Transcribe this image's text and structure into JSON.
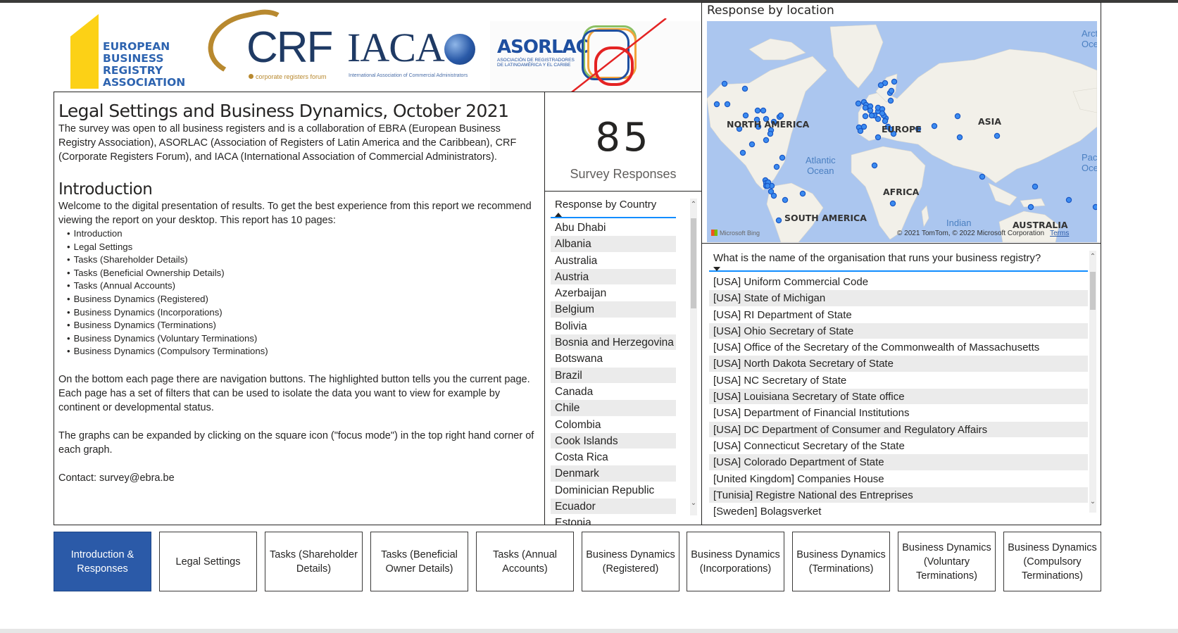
{
  "logos": {
    "ebra": {
      "lines": [
        "EUROPEAN",
        "BUSINESS",
        "REGISTRY",
        "ASSOCIATION"
      ]
    },
    "crf": {
      "name": "CRF",
      "subtitle": "corporate registers forum"
    },
    "iaca": {
      "name": "IACA",
      "subtitle": "International Association of Commercial Administrators"
    },
    "asorlac": {
      "name": "ASORLAC",
      "subtitle_1": "ASOCIACIÓN DE REGISTRADORES",
      "subtitle_2": "DE LATINOAMÉRICA Y EL CARIBE"
    }
  },
  "intro": {
    "title": "Legal Settings and Business Dynamics, October 2021",
    "description": "The survey was open to all business registers and is a collaboration of EBRA (European Business Registry Association), ASORLAC (Association of Registers of Latin America and the Caribbean), CRF (Corporate Registers Forum),  and IACA (International Association of Commercial Administrators).",
    "section_title": "Introduction",
    "welcome": "Welcome to the digital presentation of results. To get the best experience from this report we recommend viewing the report on your desktop. This report has 10 pages:",
    "pages": [
      "Introduction",
      "Legal Settings",
      "Tasks (Shareholder Details)",
      "Tasks (Beneficial Ownership Details)",
      "Tasks (Annual Accounts)",
      "Business Dynamics (Registered)",
      "Business Dynamics (Incorporations)",
      "Business Dynamics (Terminations)",
      "Business Dynamics (Voluntary Terminations)",
      "Business Dynamics (Compulsory Terminations)"
    ],
    "navigation_note": "On the bottom each page there are navigation buttons. The highlighted button tells you the current page. Each page has a set of filters that can be used to isolate the data you want to view for example by continent or developmental status.",
    "focus_note": "The graphs can be expanded by clicking on the square icon (\"focus mode\") in the top right hand corner of each graph.",
    "contact": "Contact: survey@ebra.be"
  },
  "kpi": {
    "value": "85",
    "label": "Survey Responses"
  },
  "country_table": {
    "header": "Response by Country",
    "sort": "ascending",
    "rows": [
      "Abu Dhabi",
      "Albania",
      "Australia",
      "Austria",
      "Azerbaijan",
      "Belgium",
      "Bolivia",
      "Bosnia and Herzegovina",
      "Botswana",
      "Brazil",
      "Canada",
      "Chile",
      "Colombia",
      "Cook Islands",
      "Costa Rica",
      "Denmark",
      "Dominician Republic",
      "Ecuador",
      "Estonia"
    ]
  },
  "map": {
    "title": "Response by location",
    "labels": {
      "north_america": "NORTH AMERICA",
      "south_america": "SOUTH AMERICA",
      "europe": "EUROPE",
      "asia": "ASIA",
      "africa": "AFRICA",
      "australia": "AUSTRALIA"
    },
    "oceans": {
      "atlantic": "Atlantic\nOcean",
      "indian": "Indian",
      "pacific": "Pac\nOce",
      "arctic": "Arct\nOce"
    },
    "credit": "© 2021 TomTom, © 2022 Microsoft Corporation",
    "terms": "Terms",
    "provider": "Microsoft Bing",
    "point_color": "#3b8bf0"
  },
  "org_table": {
    "header": "What is the name of the organisation that runs your business registry?",
    "sort": "descending",
    "rows": [
      "[USA] Uniform Commercial Code",
      "[USA] State of Michigan",
      "[USA] RI Department of State",
      "[USA] Ohio Secretary of State",
      "[USA] Office of the Secretary of the Commonwealth of Massachusetts",
      "[USA] North Dakota Secretary of State",
      "[USA] NC Secretary of State",
      "[USA] Louisiana Secretary of State office",
      "[USA] Department of Financial Institutions",
      "[USA] DC Department of Consumer and Regulatory Affairs",
      "[USA] Connecticut Secretary of the State",
      "[USA] Colorado Department of State",
      "[United Kingdom] Companies House",
      "[Tunisia] Registre National des Entreprises",
      "[Sweden] Bolagsverket"
    ]
  },
  "nav": {
    "active_index": 0,
    "accent": "#2b5aa8",
    "buttons": [
      "Introduction & Responses",
      "Legal Settings",
      "Tasks (Shareholder Details)",
      "Tasks (Beneficial Owner Details)",
      "Tasks (Annual Accounts)",
      "Business Dynamics (Registered)",
      "Business Dynamics (Incorporations)",
      "Business Dynamics (Terminations)",
      "Business Dynamics (Voluntary Terminations)",
      "Business Dynamics (Compulsory Terminations)"
    ]
  }
}
